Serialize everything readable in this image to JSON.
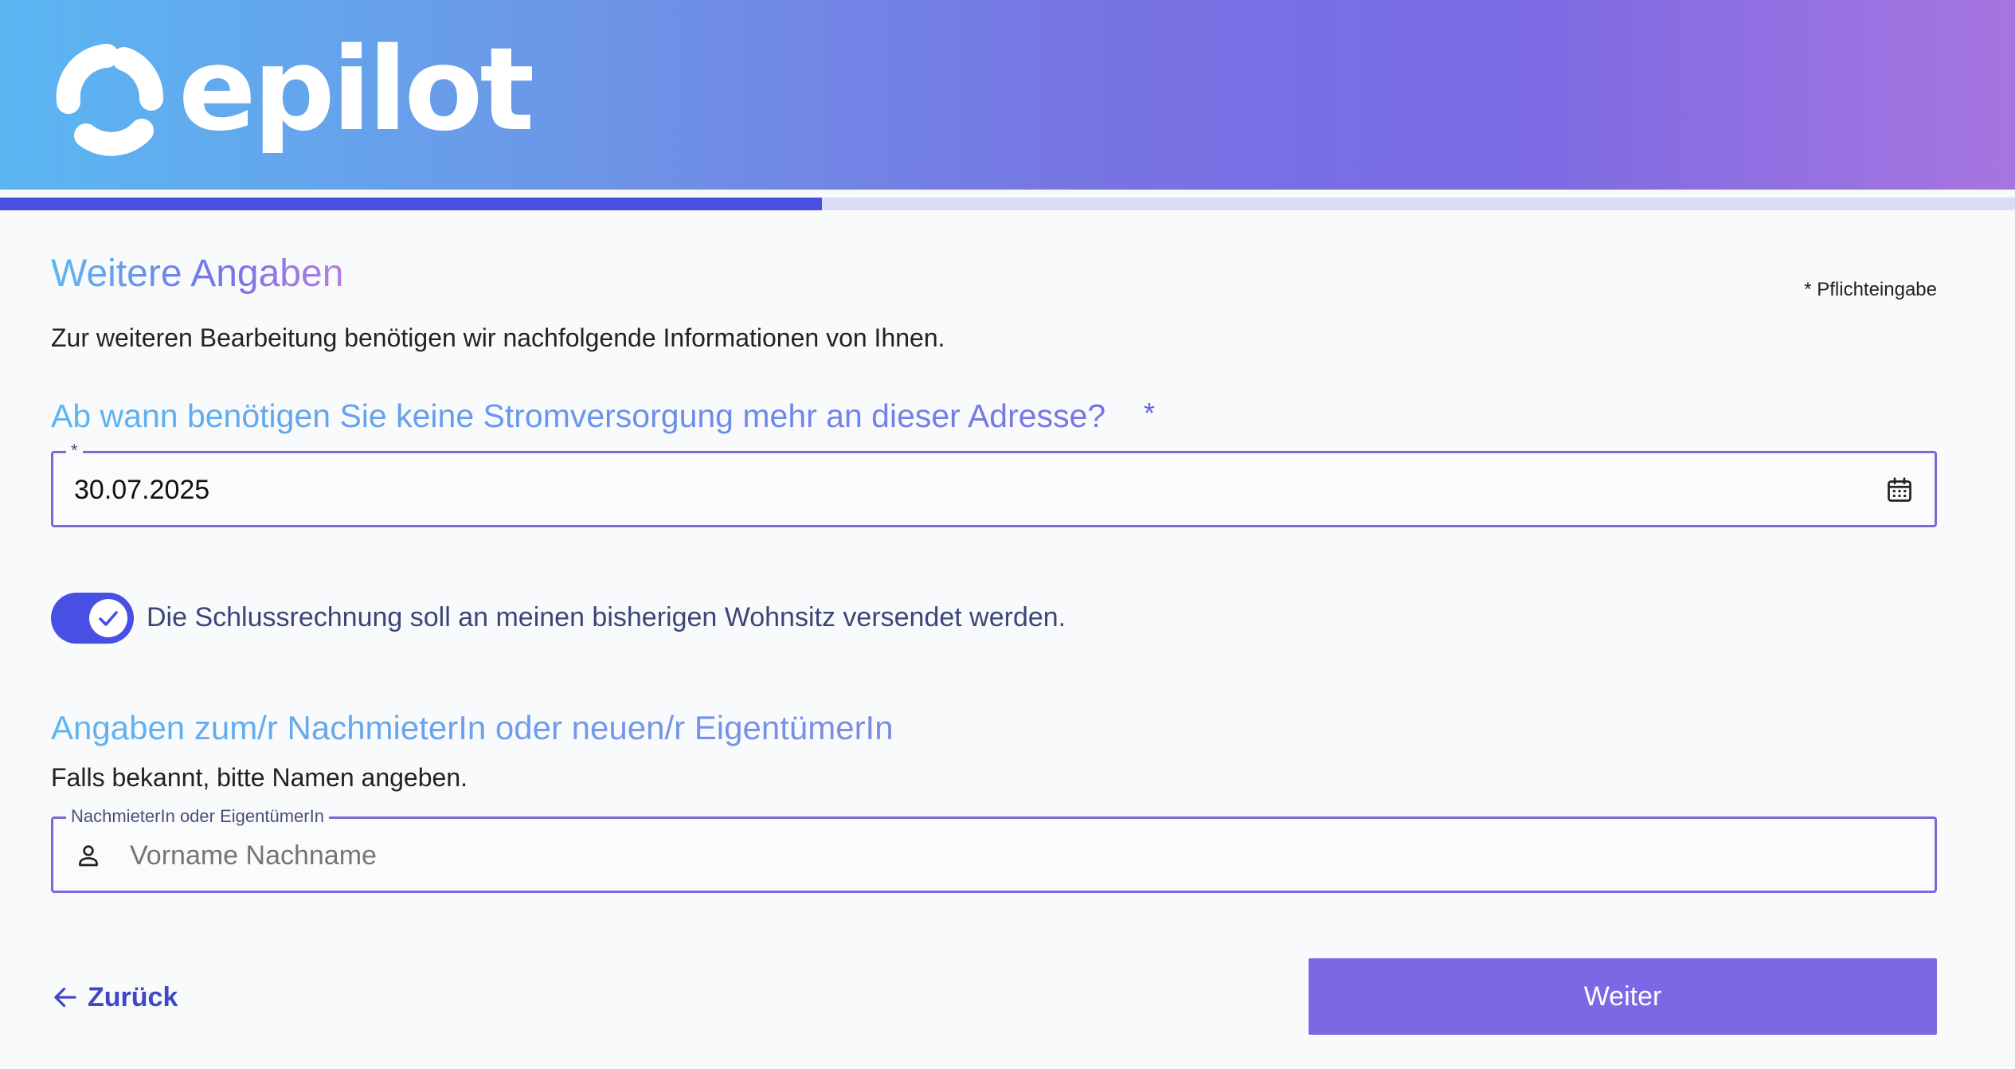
{
  "brand": {
    "name": "epilot"
  },
  "progress": {
    "percent": 40.8
  },
  "page": {
    "title": "Weitere Angaben",
    "required_note": "* Pflichteingabe",
    "intro": "Zur weiteren Bearbeitung benötigen wir nachfolgende Informationen von Ihnen."
  },
  "date_question": {
    "label": "Ab wann benötigen Sie keine Stromversorgung mehr an dieser Adresse?",
    "required_marker": "*",
    "field_legend": "*",
    "value": "30.07.2025",
    "icon": "calendar-icon"
  },
  "invoice_toggle": {
    "checked": true,
    "label": "Die Schlussrechnung soll an meinen bisherigen Wohnsitz versendet werden.",
    "icon": "check-icon"
  },
  "successor": {
    "title": "Angaben zum/r NachmieterIn oder neuen/r EigentümerIn",
    "subtitle": "Falls bekannt, bitte Namen angeben.",
    "field_legend": "NachmieterIn oder EigentümerIn",
    "placeholder": "Vorname Nachname",
    "value": "",
    "icon": "person-icon"
  },
  "nav": {
    "back_label": "Zurück",
    "back_icon": "arrow-left-icon",
    "next_label": "Weiter"
  },
  "colors": {
    "primary": "#4750e2",
    "button": "#7a68e4",
    "field_border": "#7b68d9",
    "gradient_start": "#5bb6f2",
    "gradient_end": "#a775e0"
  }
}
